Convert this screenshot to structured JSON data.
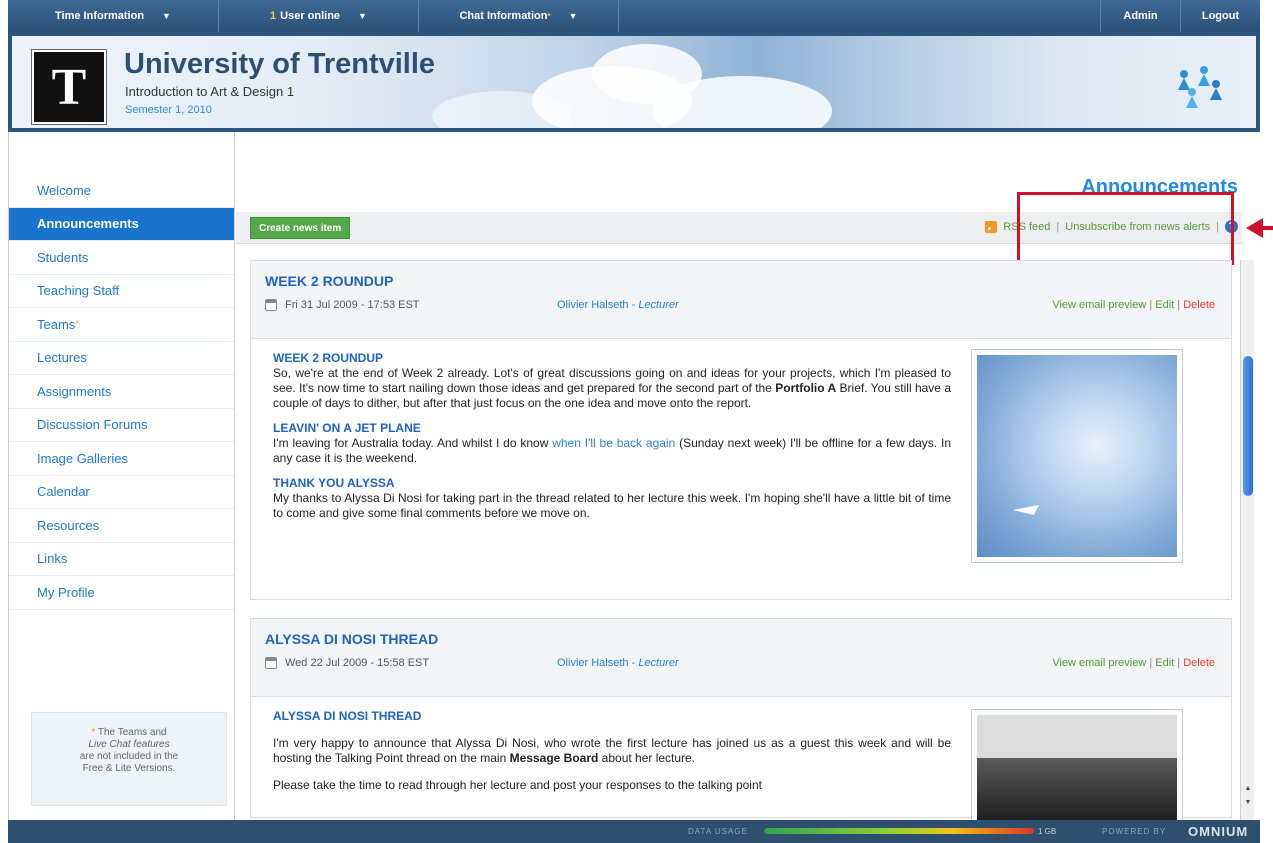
{
  "topbar": {
    "time_info": "Time Information",
    "users_count": "1",
    "users_label": "User online",
    "chat_info": "Chat Information",
    "admin": "Admin",
    "logout": "Logout"
  },
  "header": {
    "logo_letter": "T",
    "university": "University of Trentville",
    "course": "Introduction to Art & Design 1",
    "semester": "Semester 1, 2010"
  },
  "sidebar": {
    "items": [
      {
        "label": "Welcome",
        "active": false
      },
      {
        "label": "Announcements",
        "active": true
      },
      {
        "label": "Students",
        "active": false
      },
      {
        "label": "Teaching Staff",
        "active": false
      },
      {
        "label": "Teams",
        "active": false
      },
      {
        "label": "Lectures",
        "active": false
      },
      {
        "label": "Assignments",
        "active": false
      },
      {
        "label": "Discussion Forums",
        "active": false
      },
      {
        "label": "Image Galleries",
        "active": false
      },
      {
        "label": "Calendar",
        "active": false
      },
      {
        "label": "Resources",
        "active": false
      },
      {
        "label": "Links",
        "active": false
      },
      {
        "label": "My Profile",
        "active": false
      }
    ],
    "note_line1": "The Teams and",
    "note_line2": "Live Chat features",
    "note_line3": "are not included in the",
    "note_line4": "Free & Lite Versions."
  },
  "main": {
    "heading": "Announcements",
    "create_button": "Create news item",
    "rss": "RSS feed",
    "unsubscribe": "Unsubscribe from news alerts",
    "help": "?"
  },
  "news": [
    {
      "title": "WEEK 2 ROUNDUP",
      "date": "Fri 31 Jul 2009 - 17:53 EST",
      "author": "Olivier Halseth",
      "role": "Lecturer",
      "view_preview": "View email preview",
      "edit": "Edit",
      "delete": "Delete",
      "s1_title": "WEEK 2 ROUNDUP",
      "s1_text_a": "So, we're at the end of Week 2 already. Lot's of great discussions going on and ideas for your projects, which I'm pleased to see. It's now time to start nailing down those ideas and get prepared for the second part of the",
      "s1_bold": "Portfolio A",
      "s1_text_b": "Brief. You still have a couple of days to dither, but after that just focus on the one idea and move onto the report.",
      "s2_title": "LEAVIN' ON A JET PLANE",
      "s2_text_a": "I'm leaving for Australia today. And whilst I do know",
      "s2_link": "when I'll be back again",
      "s2_text_b": "(Sunday next week) I'll be offline for a few days. In any case it is the weekend.",
      "s3_title": "THANK YOU ALYSSA",
      "s3_text": "My thanks to Alyssa Di Nosi for taking part in the thread related to her lecture this week. I'm hoping she'll have a little bit of time to come and give some final comments before we move on."
    },
    {
      "title": "ALYSSA DI NOSI THREAD",
      "date": "Wed 22 Jul 2009 - 15:58 EST",
      "author": "Olivier Halseth",
      "role": "Lecturer",
      "view_preview": "View email preview",
      "edit": "Edit",
      "delete": "Delete",
      "s1_title": "ALYSSA DI NOSI THREAD",
      "p1_a": "I'm very happy to announce that Alyssa Di Nosi, who wrote the first lecture has joined us as a guest this week and will be hosting the Talking Point thread on the main",
      "p1_bold": "Message Board",
      "p1_b": "about her lecture.",
      "p2": "Please take the time to read through her lecture and post your responses to the talking point"
    }
  ],
  "footer": {
    "usage_label": "DATA USAGE",
    "usage_max": "1 GB",
    "powered": "POWERED BY",
    "brand": "OMNIUM"
  }
}
